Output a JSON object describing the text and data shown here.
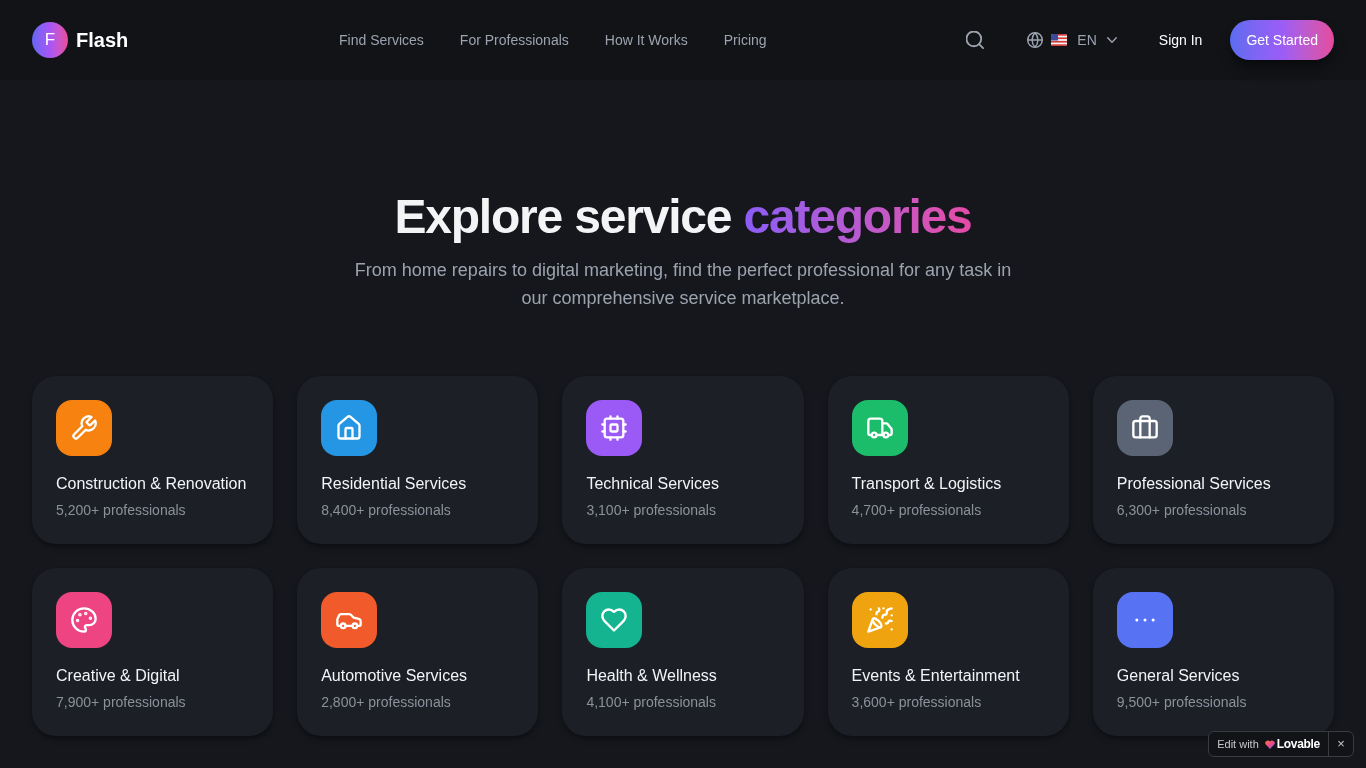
{
  "header": {
    "logo_letter": "F",
    "brand": "Flash",
    "nav": [
      {
        "label": "Find Services"
      },
      {
        "label": "For Professionals"
      },
      {
        "label": "How It Works"
      },
      {
        "label": "Pricing"
      }
    ],
    "language": "EN",
    "sign_in": "Sign In",
    "cta": "Get Started"
  },
  "hero": {
    "title": "Explore service",
    "title_highlight": "categories",
    "subtitle": "From home repairs to digital marketing, find the perfect professional for any task in our comprehensive service marketplace."
  },
  "categories": [
    {
      "name": "Construction & Renovation",
      "count": "5,200+ professionals",
      "color": "#f7820f"
    },
    {
      "name": "Residential Services",
      "count": "8,400+ professionals",
      "color": "#2596e3"
    },
    {
      "name": "Technical Services",
      "count": "3,100+ professionals",
      "color": "#9b59f6"
    },
    {
      "name": "Transport & Logistics",
      "count": "4,700+ professionals",
      "color": "#1bbd6a"
    },
    {
      "name": "Professional Services",
      "count": "6,300+ professionals",
      "color": "#5a6475"
    },
    {
      "name": "Creative & Digital",
      "count": "7,900+ professionals",
      "color": "#ee4582"
    },
    {
      "name": "Automotive Services",
      "count": "2,800+ professionals",
      "color": "#f15a2a"
    },
    {
      "name": "Health & Wellness",
      "count": "4,100+ professionals",
      "color": "#13b48f"
    },
    {
      "name": "Events & Entertainment",
      "count": "3,600+ professionals",
      "color": "#efa30f"
    },
    {
      "name": "General Services",
      "count": "9,500+ professionals",
      "color": "#5772f3"
    }
  ],
  "badge": {
    "prefix": "Edit with",
    "brand": "Lovable",
    "close": "×"
  }
}
